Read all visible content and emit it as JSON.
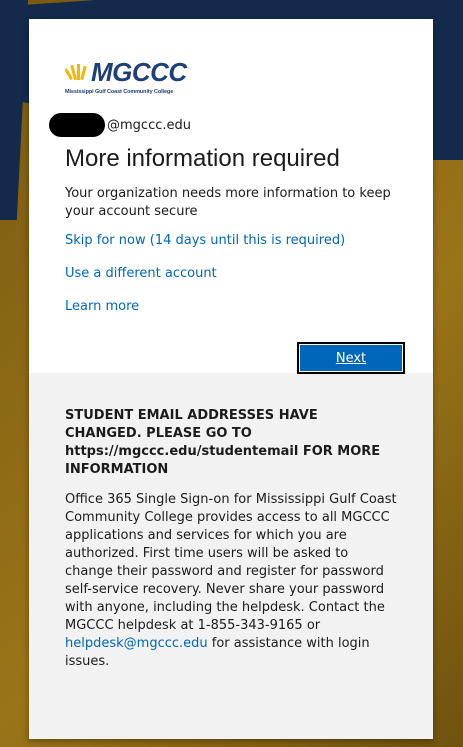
{
  "brand": {
    "logo_text": "MGCCC",
    "logo_subtitle": "Mississippi Gulf Coast Community College",
    "primary_color": "#1e3f7a",
    "accent_color": "#f2b705"
  },
  "identity": {
    "email_suffix": "@mgccc.edu"
  },
  "main": {
    "title": "More information required",
    "description": "Your organization needs more information to keep your account secure",
    "skip_link": "Skip for now (14 days until this is required)",
    "different_account_link": "Use a different account",
    "learn_more_link": "Learn more",
    "next_button": "Next"
  },
  "footer": {
    "notice": "STUDENT EMAIL ADDRESSES HAVE CHANGED. PLEASE GO TO https://mgccc.edu/studentemail FOR MORE INFORMATION",
    "info_text": "Office 365 Single Sign-on for Mississippi Gulf Coast Community College provides access to all MGCCC applications and services for which you are authorized. First time users will be asked to change their password and register for password self-service recovery. Never share your password with anyone, including the helpdesk. Contact the MGCCC helpdesk at 1-855-343-9165 or",
    "helpdesk_email": "helpdesk@mgccc.edu",
    "info_suffix": "for assistance with login issues."
  },
  "colors": {
    "link": "#0067b8",
    "button": "#0067b8",
    "background_gold": "#8a6614",
    "background_navy": "#142a4c",
    "footer_bg": "#f2f2f2"
  }
}
